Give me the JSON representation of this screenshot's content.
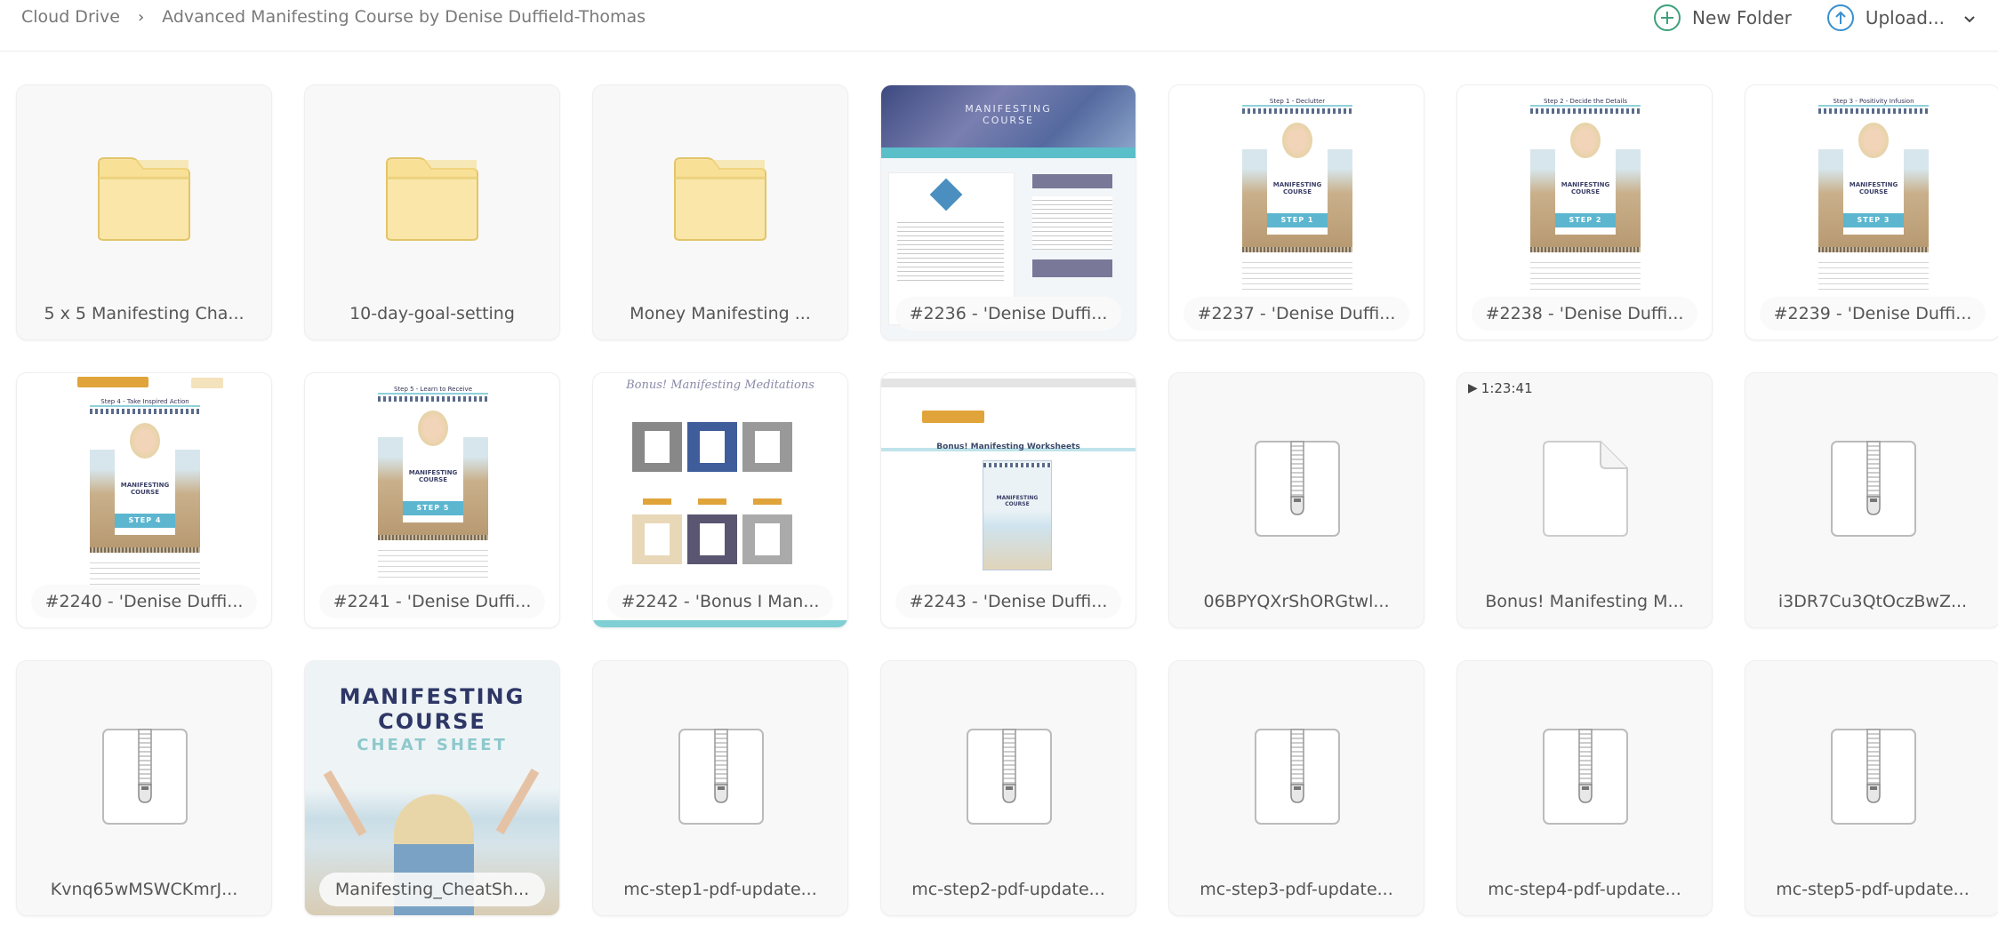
{
  "breadcrumb": {
    "root": "Cloud Drive",
    "separator": "›",
    "current": "Advanced Manifesting Course by Denise Duffield-Thomas"
  },
  "actions": {
    "new_folder": "New Folder",
    "upload": "Upload...",
    "colors": {
      "new_folder_icon": "#3ea07a",
      "upload_icon": "#3a8fcf"
    }
  },
  "items": [
    {
      "name": "5 x 5 Manifesting Cha...",
      "type": "folder"
    },
    {
      "name": "10-day-goal-setting",
      "type": "folder"
    },
    {
      "name": "Money Manifesting ...",
      "type": "folder"
    },
    {
      "name": "#2236 - 'Denise Duffi...",
      "type": "image",
      "thumbnail": "course-page"
    },
    {
      "name": "#2237 - 'Denise Duffi...",
      "type": "image",
      "thumbnail": "step",
      "step_title": "Step 1 - Declutter",
      "step_badge": "STEP 1"
    },
    {
      "name": "#2238 - 'Denise Duffi...",
      "type": "image",
      "thumbnail": "step",
      "step_title": "Step 2 - Decide the Details",
      "step_badge": "STEP 2"
    },
    {
      "name": "#2239 - 'Denise Duffi...",
      "type": "image",
      "thumbnail": "step",
      "step_title": "Step 3 - Positivity Infusion",
      "step_badge": "STEP 3"
    },
    {
      "name": "#2240 - 'Denise Duffi...",
      "type": "image",
      "thumbnail": "step",
      "step_title": "Step 4 - Take Inspired Action",
      "step_badge": "STEP 4"
    },
    {
      "name": "#2241 - 'Denise Duffi...",
      "type": "image",
      "thumbnail": "step",
      "step_title": "Step 5 - Learn to Receive",
      "step_badge": "STEP 5"
    },
    {
      "name": "#2242 - 'Bonus I Man...",
      "type": "image",
      "thumbnail": "bonus-meditations",
      "thumb_title": "Bonus! Manifesting Meditations"
    },
    {
      "name": "#2243 - 'Denise Duffi...",
      "type": "image",
      "thumbnail": "bonus-worksheets",
      "thumb_title": "Bonus! Manifesting Worksheets"
    },
    {
      "name": "06BPYQXrShORGtwl...",
      "type": "zip"
    },
    {
      "name": "Bonus! Manifesting M...",
      "type": "video",
      "duration": "1:23:41"
    },
    {
      "name": "i3DR7Cu3QtOczBwZ...",
      "type": "zip"
    },
    {
      "name": "Kvnq65wMSWCKmrJ...",
      "type": "zip"
    },
    {
      "name": "Manifesting_CheatSh...",
      "type": "image",
      "thumbnail": "cheat-sheet",
      "thumb_lines": [
        "MANIFESTING",
        "COURSE",
        "CHEAT SHEET"
      ]
    },
    {
      "name": "mc-step1-pdf-update...",
      "type": "zip"
    },
    {
      "name": "mc-step2-pdf-update...",
      "type": "zip"
    },
    {
      "name": "mc-step3-pdf-update...",
      "type": "zip"
    },
    {
      "name": "mc-step4-pdf-update...",
      "type": "zip"
    },
    {
      "name": "mc-step5-pdf-update...",
      "type": "zip"
    }
  ]
}
